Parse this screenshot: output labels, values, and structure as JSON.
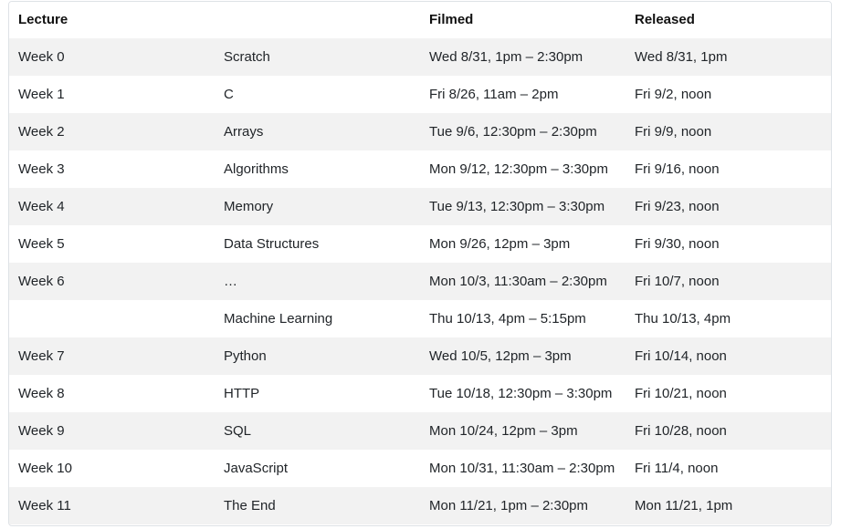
{
  "table": {
    "headers": [
      "Lecture",
      "",
      "Filmed",
      "Released"
    ],
    "rows": [
      [
        "Week 0",
        "Scratch",
        "Wed 8/31, 1pm – 2:30pm",
        "Wed 8/31, 1pm"
      ],
      [
        "Week 1",
        "C",
        "Fri 8/26, 11am – 2pm",
        "Fri 9/2, noon"
      ],
      [
        "Week 2",
        "Arrays",
        "Tue 9/6, 12:30pm – 2:30pm",
        "Fri 9/9, noon"
      ],
      [
        "Week 3",
        "Algorithms",
        "Mon 9/12, 12:30pm – 3:30pm",
        "Fri 9/16, noon"
      ],
      [
        "Week 4",
        "Memory",
        "Tue 9/13, 12:30pm – 3:30pm",
        "Fri 9/23, noon"
      ],
      [
        "Week 5",
        "Data Structures",
        "Mon 9/26, 12pm – 3pm",
        "Fri 9/30, noon"
      ],
      [
        "Week 6",
        "…",
        "Mon 10/3, 11:30am – 2:30pm",
        "Fri 10/7, noon"
      ],
      [
        "",
        "Machine Learning",
        "Thu 10/13, 4pm – 5:15pm",
        "Thu 10/13, 4pm"
      ],
      [
        "Week 7",
        "Python",
        "Wed 10/5, 12pm – 3pm",
        "Fri 10/14, noon"
      ],
      [
        "Week 8",
        "HTTP",
        "Tue 10/18, 12:30pm – 3:30pm",
        "Fri 10/21, noon"
      ],
      [
        "Week 9",
        "SQL",
        "Mon 10/24, 12pm – 3pm",
        "Fri 10/28, noon"
      ],
      [
        "Week 10",
        "JavaScript",
        "Mon 10/31, 11:30am – 2:30pm",
        "Fri 11/4, noon"
      ],
      [
        "Week 11",
        "The End",
        "Mon 11/21, 1pm – 2:30pm",
        "Mon 11/21, 1pm"
      ]
    ]
  }
}
